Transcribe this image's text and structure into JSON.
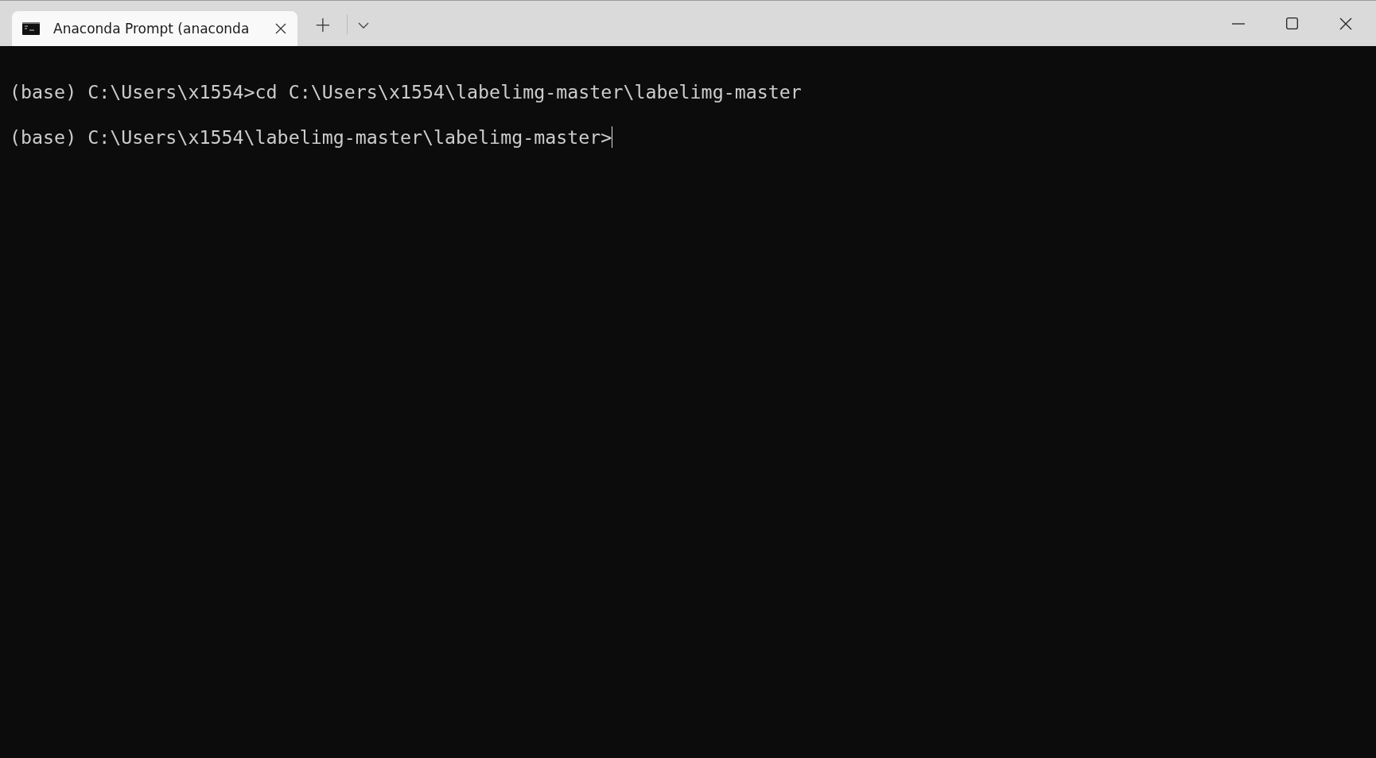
{
  "tabs": [
    {
      "title": "Anaconda Prompt (anaconda",
      "selected": true
    }
  ],
  "new_tab": {
    "label": "+"
  },
  "console": {
    "lines": [
      "(base) C:\\Users\\x1554>cd C:\\Users\\x1554\\labelimg-master\\labelimg-master",
      "(base) C:\\Users\\x1554\\labelimg-master\\labelimg-master>"
    ]
  }
}
